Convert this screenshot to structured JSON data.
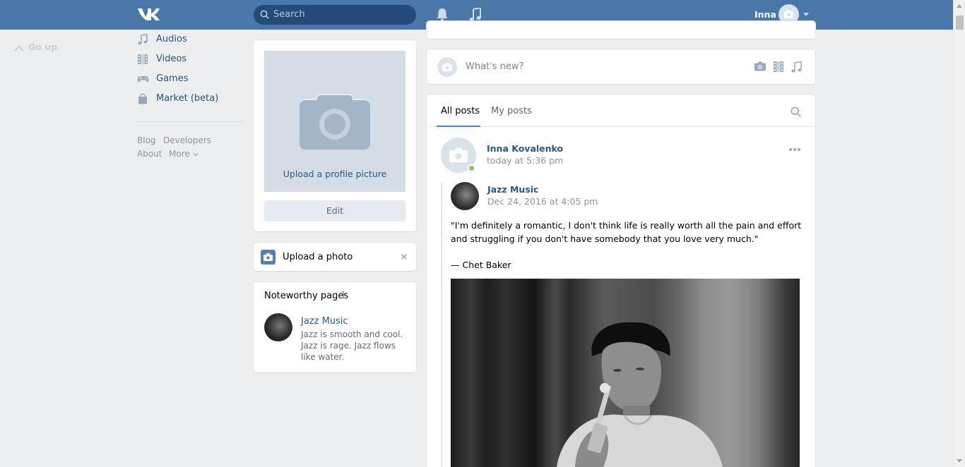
{
  "header": {
    "search_placeholder": "Search",
    "user_name": "Inna"
  },
  "go_up": "Go up",
  "left_menu": {
    "items": [
      {
        "label": "Audios",
        "icon": "music-note-icon"
      },
      {
        "label": "Videos",
        "icon": "film-icon"
      },
      {
        "label": "Games",
        "icon": "gamepad-icon"
      },
      {
        "label": "Market (beta)",
        "icon": "shopping-bag-icon"
      }
    ],
    "footer": {
      "blog": "Blog",
      "developers": "Developers",
      "about": "About",
      "more": "More"
    }
  },
  "profile": {
    "upload_picture": "Upload a profile picture",
    "edit_label": "Edit"
  },
  "upload_photo": {
    "label": "Upload a photo",
    "close": "✕"
  },
  "noteworthy": {
    "title": "Noteworthy pages",
    "count": "1",
    "page": {
      "name": "Jazz Music",
      "description": "Jazz is smooth and cool. Jazz is rage. Jazz flows like water."
    }
  },
  "composer": {
    "placeholder": "What's new?"
  },
  "feed": {
    "tabs": [
      "All posts",
      "My posts"
    ],
    "active_tab": 0
  },
  "post": {
    "author": "Inna Kovalenko",
    "date": "today at 5:36 pm",
    "repost": {
      "author": "Jazz Music",
      "date": "Dec 24, 2016 at 4:05 pm",
      "text": "\"I'm definitely a romantic, I don't think life is really worth all the pain and effort and struggling if you don't have somebody that you love very much.\"",
      "signature": "— Chet Baker"
    }
  },
  "colors": {
    "header_bg": "#4a76a8",
    "link": "#2a5885",
    "page_bg": "#edeef0",
    "online": "#8ac176"
  }
}
